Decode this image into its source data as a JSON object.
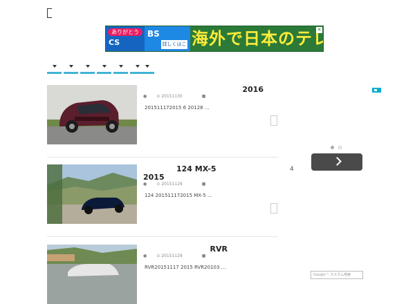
{
  "header": {
    "logo_icon": "bracket-glyph"
  },
  "banner": {
    "badge_text": "ありがとう",
    "cs_text": "CS",
    "bs_text": "BS",
    "sub_text": "詳しくはこちら",
    "headline": "海外で日本のテレビ",
    "close_icon": "close-icon",
    "colors": {
      "bg": "#2b7a37",
      "headline": "#ffeb3b",
      "badge": "#e91e63"
    }
  },
  "nav": {
    "tab_count": 7,
    "accent": "#3fb3d6"
  },
  "articles": [
    {
      "title": "2016",
      "date": "20151130",
      "excerpt": "201511172015 6 20128 ...",
      "thumb": "red-hatchback-photo"
    },
    {
      "title": "124           MX-5",
      "title2": "2015",
      "date": "20151129",
      "excerpt": "124 201511172015  MX-5 ...",
      "thumb": "convertible-photo"
    },
    {
      "title": "RVR",
      "date": "20151129",
      "excerpt": "RVR20151117 2015 RVR20103 ...",
      "thumb": "suv-coast-photo"
    }
  ],
  "sidebar": {
    "stray_text": "4",
    "search_placeholder": "Google™ カスタム検索"
  }
}
